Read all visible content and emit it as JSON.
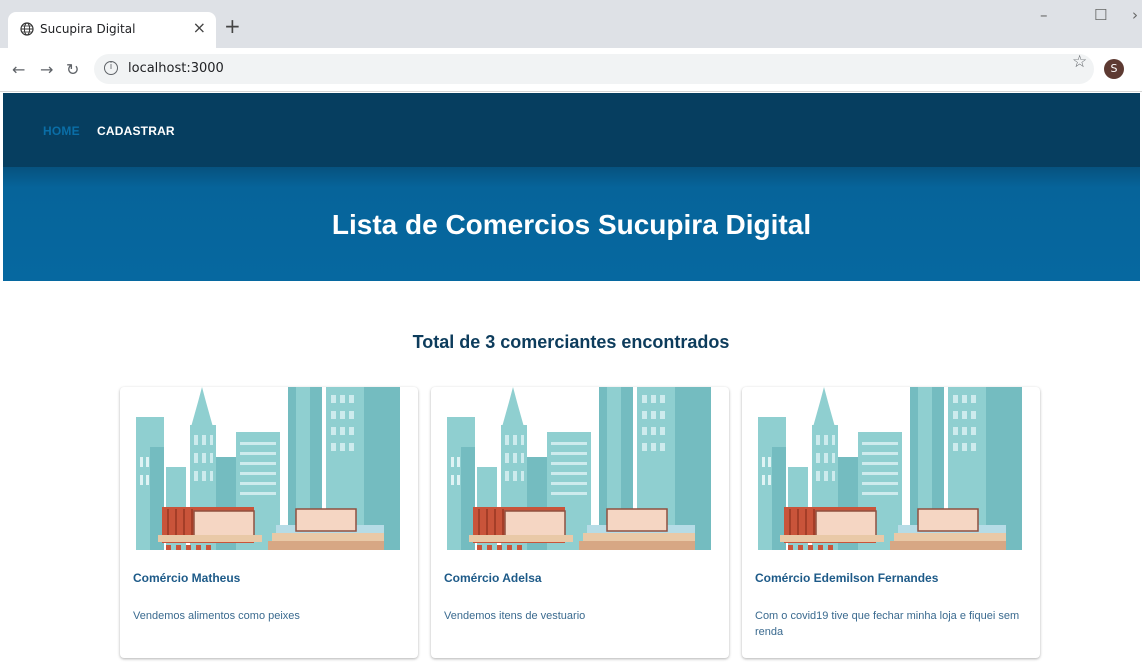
{
  "browser": {
    "tab_title": "Sucupira Digital",
    "tab_close": "×",
    "new_tab": "+",
    "url": "localhost:3000",
    "profile_initial": "S",
    "icons": [
      "globe-icon",
      "close-icon",
      "plus-icon",
      "back-arrow-icon",
      "forward-arrow-icon",
      "reload-icon",
      "info-icon",
      "star-icon"
    ]
  },
  "nav": {
    "home": "HOME",
    "cadastrar": "CADASTRAR"
  },
  "hero": {
    "title": "Lista de Comercios Sucupira Digital"
  },
  "total_text": "Total de 3 comerciantes encontrados",
  "cards": [
    {
      "title": "Comércio Matheus",
      "description": "Vendemos alimentos como peixes"
    },
    {
      "title": "Comércio Adelsa",
      "description": "Vendemos itens de vestuario"
    },
    {
      "title": "Comércio Edemilson Fernandes",
      "description": "Com o covid19 tive que fechar minha loja e fiquei sem renda"
    }
  ],
  "colors": {
    "navbar": "#063e60",
    "hero": "#0668a0",
    "accent": "#1d5a88"
  }
}
